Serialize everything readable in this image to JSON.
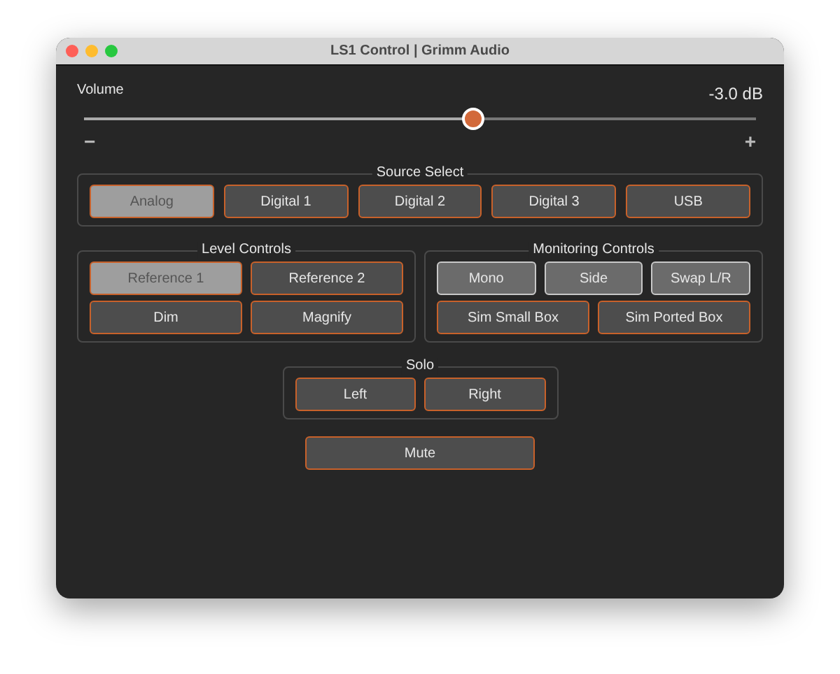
{
  "window": {
    "title": "LS1 Control | Grimm Audio"
  },
  "volume": {
    "label": "Volume",
    "reading": "-3.0 dB",
    "level": 0.58,
    "min_label": "−",
    "max_label": "+"
  },
  "groups": [
    {
      "title": "Source Select",
      "buttons": [
        {
          "label": "Analog",
          "kind": "toggle",
          "selected": true
        },
        {
          "label": "Digital 1",
          "kind": "toggle",
          "selected": false
        },
        {
          "label": "Digital 2",
          "kind": "toggle",
          "selected": false
        },
        {
          "label": "Digital 3",
          "kind": "toggle",
          "selected": false
        },
        {
          "label": "USB",
          "kind": "toggle",
          "selected": false
        }
      ]
    },
    {
      "title": "Level Controls",
      "buttons": [
        {
          "label": "Reference 1",
          "kind": "toggle",
          "selected": true
        },
        {
          "label": "Reference 2",
          "kind": "toggle",
          "selected": false
        },
        {
          "label": "Dim",
          "kind": "toggle",
          "selected": false
        },
        {
          "label": "Magnify",
          "kind": "toggle",
          "selected": false
        }
      ]
    },
    {
      "title": "Monitoring Controls",
      "buttons": [
        {
          "label": "Mono",
          "kind": "plain",
          "selected": false
        },
        {
          "label": "Side",
          "kind": "plain",
          "selected": false
        },
        {
          "label": "Swap L/R",
          "kind": "plain",
          "selected": false
        },
        {
          "label": "Sim Small Box",
          "kind": "toggle",
          "selected": false
        },
        {
          "label": "Sim Ported Box",
          "kind": "toggle",
          "selected": false
        }
      ]
    },
    {
      "title": "Solo",
      "buttons": [
        {
          "label": "Left",
          "kind": "toggle",
          "selected": false
        },
        {
          "label": "Right",
          "kind": "toggle",
          "selected": false
        }
      ]
    }
  ],
  "mute": {
    "label": "Mute",
    "kind": "toggle",
    "selected": false
  }
}
